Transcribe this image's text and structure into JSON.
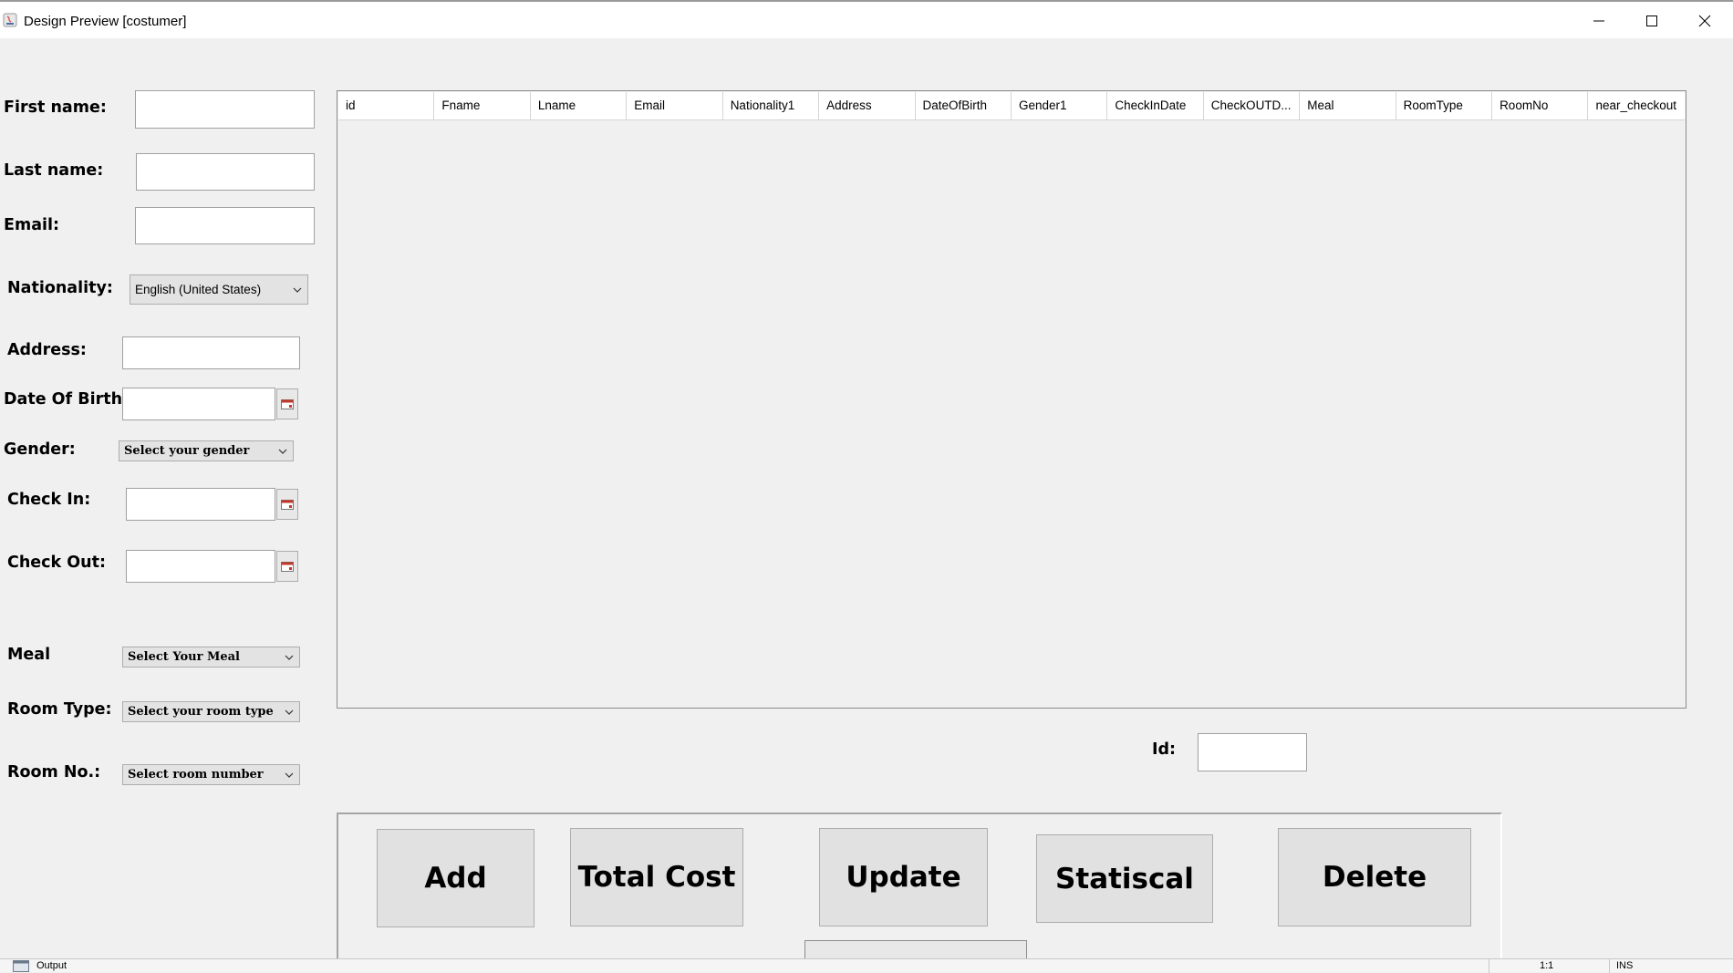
{
  "window": {
    "title": "Design Preview [costumer]"
  },
  "form": {
    "first_name_label": "First name:",
    "last_name_label": "Last name:",
    "email_label": "Email:",
    "nationality_label": "Nationality:",
    "nationality_value": "English (United States)",
    "address_label": "Address:",
    "dob_label": "Date Of Birth:",
    "gender_label": "Gender:",
    "gender_value": "Select your gender",
    "check_in_label": "Check In:",
    "check_out_label": "Check Out:",
    "meal_label": "Meal",
    "meal_value": "Select Your Meal",
    "room_type_label": "Room Type:",
    "room_type_value": "Select your room type",
    "room_no_label": "Room No.:",
    "room_no_value": "Select room number"
  },
  "table": {
    "columns": [
      "id",
      "Fname",
      "Lname",
      "Email",
      "Nationality1",
      "Address",
      "DateOfBirth",
      "Gender1",
      "CheckInDate",
      "CheckOUTD...",
      "Meal",
      "RoomType",
      "RoomNo",
      "near_checkout"
    ]
  },
  "id_field": {
    "label": "Id:"
  },
  "buttons": {
    "add": "Add",
    "total_cost": "Total Cost",
    "update": "Update",
    "statistical": "Statiscal",
    "delete": "Delete"
  },
  "statusbar": {
    "output": "Output",
    "position": "1:1",
    "mode": "INS"
  },
  "colors": {
    "background": "#f0f0f0",
    "button": "#e1e1e1"
  }
}
